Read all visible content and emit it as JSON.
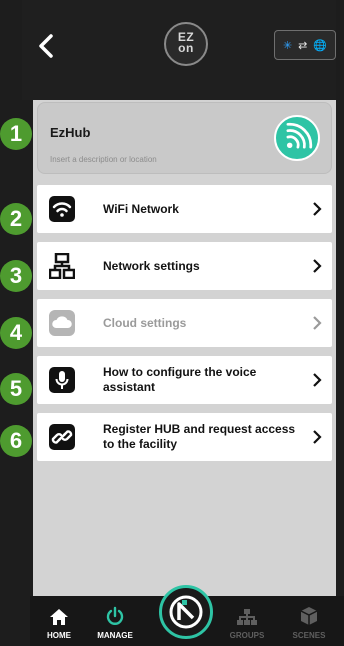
{
  "header": {
    "logo_text_top": "EZ",
    "logo_text_bottom": "on"
  },
  "hub": {
    "name": "EzHub",
    "description_placeholder": "Insert a description or location"
  },
  "menu": {
    "items": [
      {
        "badge": "2",
        "label": "WiFi Network",
        "icon": "wifi-icon",
        "enabled": true
      },
      {
        "badge": "3",
        "label": "Network settings",
        "icon": "network-icon",
        "enabled": true
      },
      {
        "badge": "4",
        "label": "Cloud settings",
        "icon": "cloud-icon",
        "enabled": false
      },
      {
        "badge": "5",
        "label": "How to configure the voice assistant",
        "icon": "microphone-icon",
        "enabled": true
      },
      {
        "badge": "6",
        "label": "Register HUB and request access to the facility",
        "icon": "link-icon",
        "enabled": true
      }
    ]
  },
  "hub_badge": "1",
  "nav": {
    "home": "HOME",
    "manage": "MANAGE",
    "groups": "GROUPS",
    "scenes": "SCENES"
  },
  "colors": {
    "accent": "#2ec4a5",
    "badge": "#4e9b2f",
    "nav_active": "#ffffff",
    "nav_manage": "#2ec4a5",
    "nav_inactive": "#5f5f5f"
  }
}
